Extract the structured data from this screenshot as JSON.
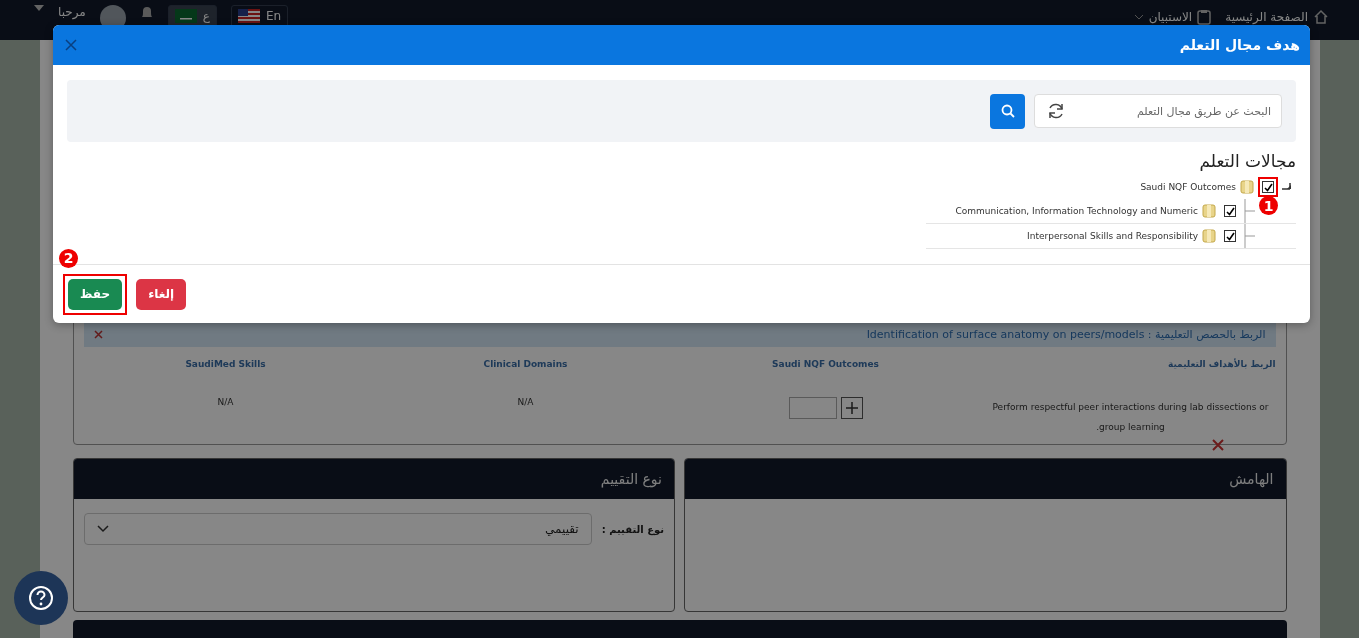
{
  "navbar": {
    "links": [
      {
        "label": "الصفحة الرئيسية",
        "kind": "home"
      },
      {
        "label": "الاستبيان",
        "kind": "survey"
      }
    ],
    "languages": [
      {
        "label": "En",
        "kind": "us",
        "selected": false
      },
      {
        "label": "ع",
        "kind": "sa",
        "selected": true
      }
    ],
    "greeting": "مرحبا"
  },
  "link_card": {
    "lesson_link": "الربط بالحصص التعليمية : Identification of surface anatomy on peers/models",
    "columns": [
      "الربط بالأهداف التعليمية",
      "Saudi NQF Outcomes",
      "Clinical Domains",
      "SaudiMed Skills"
    ],
    "row": {
      "objective": "Perform respectful peer interactions during lab dissections or group learning.",
      "clinical_domains": "N/A",
      "saudimed_skills": "N/A"
    }
  },
  "panels": [
    {
      "title": "الهامش"
    },
    {
      "title": "نوع التقييم",
      "field_label": "نوع التقييم :",
      "value": "تقييمي"
    }
  ],
  "modal": {
    "title": "هدف مجال التعلم",
    "search_placeholder": "البحث عن طريق مجال التعلم",
    "tree_title": "مجالات التعلم",
    "tree": [
      {
        "label": "Saudi NQF Outcomes",
        "checked": true,
        "callout": "1",
        "children": [
          {
            "label": "Communication, Information Technology and Numeric",
            "checked": true
          },
          {
            "label": "Interpersonal Skills and Responsibility",
            "checked": true
          }
        ]
      }
    ],
    "buttons": [
      {
        "label": "إلغاء",
        "kind": "cancel"
      },
      {
        "label": "حفظ",
        "kind": "save",
        "callout": "2"
      }
    ]
  }
}
